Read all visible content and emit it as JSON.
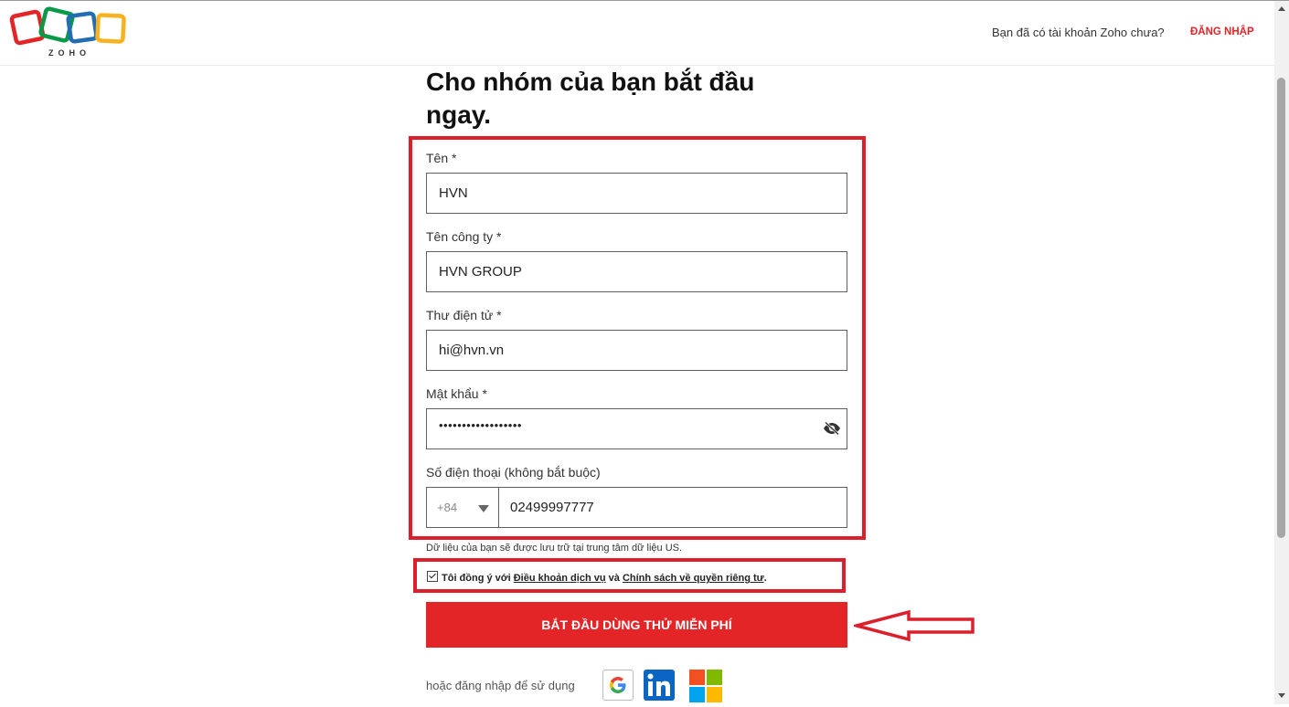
{
  "header": {
    "logo_text": "ZOHO",
    "has_account_text": "Bạn đã có tài khoản Zoho chưa?",
    "login_label": "ĐĂNG NHẬP"
  },
  "form": {
    "title": "Cho nhóm của bạn bắt đầu ngay.",
    "name": {
      "label": "Tên *",
      "value": "HVN"
    },
    "company": {
      "label": "Tên công ty *",
      "value": "HVN GROUP"
    },
    "email": {
      "label": "Thư điện tử *",
      "value": "hi@hvn.vn"
    },
    "password": {
      "label": "Mật khẩu *",
      "masked_value": "••••••••••••••••••"
    },
    "phone": {
      "label": "Số điện thoại (không bắt buộc)",
      "country_code": "+84",
      "value": "02499997777"
    },
    "data_note": "Dữ liệu của bạn sẽ được lưu trữ tại trung tâm dữ liệu US.",
    "consent": {
      "prefix": "Tôi đồng ý với",
      "terms_link": "Điều khoản dịch vụ",
      "middle": "và",
      "privacy_link": "Chính sách về quyền riêng tư",
      "suffix": "."
    },
    "submit_label": "BẮT ĐẦU DÙNG THỬ MIỄN PHÍ",
    "alt_login_text": "hoặc đăng nhập để sử dụng"
  },
  "colors": {
    "brand_red": "#e42527",
    "annotation_red": "#dd1f2c",
    "logo_red": "#e42527",
    "logo_green": "#089949",
    "logo_blue": "#226db4",
    "logo_yellow": "#f9b21d"
  },
  "icons": [
    "eye-icon",
    "chevron-down-icon",
    "checkbox-checked-icon",
    "google-icon",
    "linkedin-icon",
    "microsoft-icon",
    "arrow-left-annotation"
  ]
}
